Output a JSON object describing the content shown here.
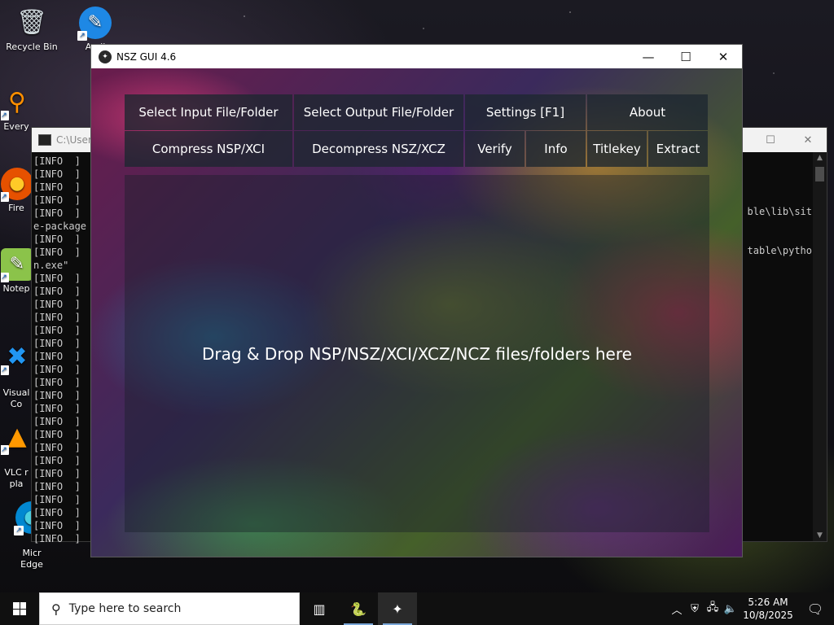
{
  "desktop": {
    "icons": [
      {
        "label": "Recycle Bin"
      },
      {
        "label": "Audi"
      },
      {
        "label": "Every"
      },
      {
        "label": "Fire"
      },
      {
        "label": "Notep"
      },
      {
        "label": "Visual\nCo"
      },
      {
        "label": "VLC r\npla"
      },
      {
        "label": "Micr\nEdge"
      }
    ]
  },
  "console": {
    "title": "C:\\Users",
    "left_lines": [
      "[INFO  ]",
      "[INFO  ]",
      "[INFO  ]",
      "[INFO  ]",
      "[INFO  ]",
      "e-package",
      "[INFO  ]",
      "[INFO  ]",
      "n.exe\"",
      "[INFO  ]",
      "[INFO  ]",
      "[INFO  ]",
      "[INFO  ]",
      "[INFO  ]",
      "[INFO  ]",
      "[INFO  ]",
      "[INFO  ]",
      "[INFO  ]",
      "[INFO  ]",
      "[INFO  ]",
      "[INFO  ]",
      "[INFO  ]",
      "[INFO  ]",
      "[INFO  ]",
      "[INFO  ]",
      "[INFO  ]",
      "[INFO  ]",
      "[INFO  ]",
      "[INFO  ]",
      "[INFO  ]"
    ],
    "right_line_1": "ble\\lib\\sit",
    "right_line_2": "table\\pytho",
    "controls": {
      "maximize": "☐",
      "close": "✕"
    }
  },
  "app": {
    "title": "NSZ GUI 4.6",
    "controls": {
      "minimize": "—",
      "maximize": "☐",
      "close": "✕"
    },
    "row1": [
      {
        "label": "Select Input File/Folder"
      },
      {
        "label": "Select Output File/Folder"
      },
      {
        "label": "Settings [F1]"
      },
      {
        "label": "About"
      }
    ],
    "row2": [
      {
        "label": "Compress NSP/XCI"
      },
      {
        "label": "Decompress NSZ/XCZ"
      },
      {
        "label": "Verify"
      },
      {
        "label": "Info"
      },
      {
        "label": "Titlekey"
      },
      {
        "label": "Extract"
      }
    ],
    "dropzone_text": "Drag & Drop NSP/NSZ/XCI/XCZ/NCZ files/folders here"
  },
  "taskbar": {
    "search_placeholder": "Type here to search",
    "time": "5:26 AM",
    "date": "10/8/2025"
  }
}
